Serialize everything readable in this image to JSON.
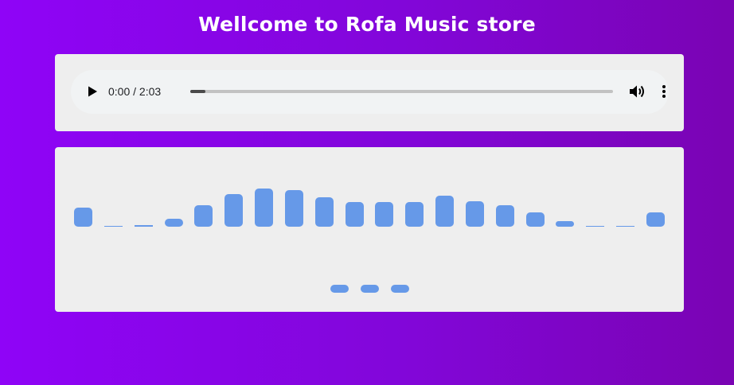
{
  "page": {
    "title": "Wellcome to Rofa Music store"
  },
  "player": {
    "time_display": "0:00 / 2:03",
    "progress_fraction": 0.035,
    "icons": {
      "play": "play-icon",
      "volume": "volume-icon",
      "menu": "more-vert-icon"
    }
  },
  "visualizer": {
    "bar_color": "#6699e8",
    "bar_levels": [
      0.4,
      0.02,
      0.03,
      0.17,
      0.45,
      0.68,
      0.8,
      0.77,
      0.62,
      0.52,
      0.52,
      0.52,
      0.65,
      0.53,
      0.45,
      0.3,
      0.12,
      0.02,
      0.02,
      0.3
    ],
    "dots_count": 3
  }
}
